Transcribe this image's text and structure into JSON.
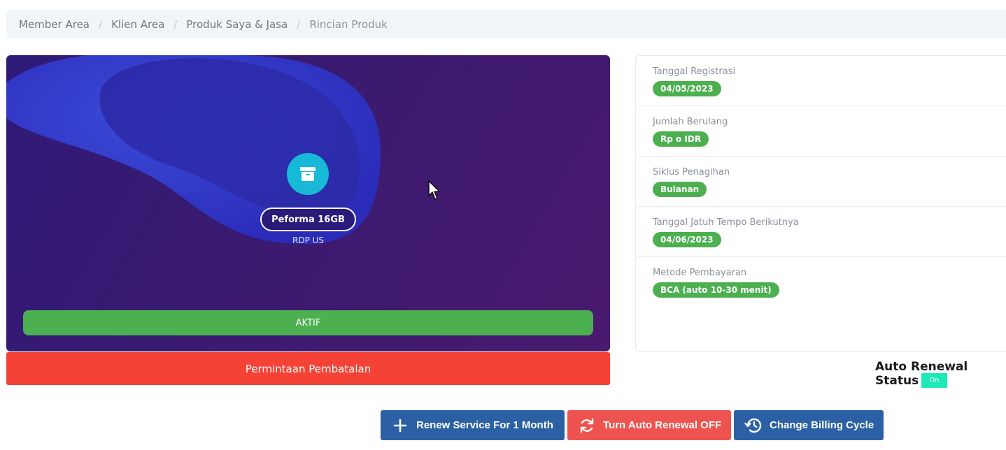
{
  "breadcrumb": [
    {
      "label": "Member Area"
    },
    {
      "label": "Klien Area"
    },
    {
      "label": "Produk Saya & Jasa"
    },
    {
      "label": "Rincian Produk"
    }
  ],
  "product": {
    "name": "Peforma 16GB",
    "group": "RDP US",
    "status": "AKTIF",
    "icon": "archive-box-icon",
    "status_color": "#4caf50"
  },
  "cancel_label": "Permintaan Pembatalan",
  "details": [
    {
      "label": "Tanggal Registrasi",
      "value": "04/05/2023"
    },
    {
      "label": "Jumlah Berulang",
      "value": "Rp o IDR"
    },
    {
      "label": "Siklus Penagihan",
      "value": "Bulanan"
    },
    {
      "label": "Tanggal Jatuh Tempo Berikutnya",
      "value": "04/06/2023"
    },
    {
      "label": "Metode Pembayaran",
      "value": "BCA (auto 10-30 menit)"
    }
  ],
  "auto_renewal": {
    "title": "Auto Renewal Status",
    "status": "On"
  },
  "actions": {
    "renew": "Renew Service For 1 Month",
    "auto_off": "Turn Auto Renewal OFF",
    "billing_cycle": "Change Billing Cycle"
  },
  "colors": {
    "primary": "#2b60a4",
    "danger": "#f44336",
    "success": "#4caf50",
    "accent": "#17b9d6"
  }
}
